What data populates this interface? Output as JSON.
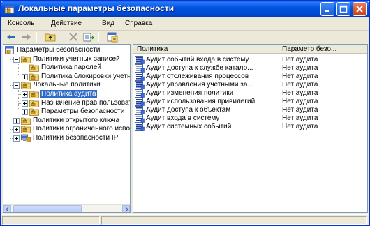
{
  "window": {
    "title": "Локальные параметры безопасности"
  },
  "menu": [
    "Консоль",
    "Действие",
    "Вид",
    "Справка"
  ],
  "toolbar": {
    "buttons": [
      "back-icon",
      "forward-icon",
      "up-folder-icon",
      "delete-icon",
      "export-list-icon",
      "properties-icon"
    ]
  },
  "tree": {
    "items": [
      {
        "label": "Параметры безопасности",
        "icon": "security-settings-icon",
        "level": 0,
        "expander": "minus"
      },
      {
        "label": "Политики учетных записей",
        "icon": "folder-icon",
        "level": 1,
        "expander": "minus"
      },
      {
        "label": "Политика паролей",
        "icon": "folder-icon",
        "level": 2,
        "expander": "none"
      },
      {
        "label": "Политика блокировки учетной записи",
        "icon": "folder-icon",
        "level": 2,
        "expander": "plus"
      },
      {
        "label": "Локальные политики",
        "icon": "folder-icon",
        "level": 1,
        "expander": "minus"
      },
      {
        "label": "Политика аудита",
        "icon": "folder-icon",
        "level": 2,
        "expander": "plus",
        "selected": true
      },
      {
        "label": "Назначение прав пользователя",
        "icon": "folder-icon",
        "level": 2,
        "expander": "plus"
      },
      {
        "label": "Параметры безопасности",
        "icon": "folder-icon",
        "level": 2,
        "expander": "plus"
      },
      {
        "label": "Политики открытого ключа",
        "icon": "folder-icon",
        "level": 1,
        "expander": "plus"
      },
      {
        "label": "Политики ограниченного использования программ",
        "icon": "folder-icon",
        "level": 1,
        "expander": "plus"
      },
      {
        "label": "Политики безопасности IP",
        "icon": "ip-security-icon",
        "level": 1,
        "expander": "plus"
      }
    ]
  },
  "list": {
    "columns": [
      "Политика",
      "Параметр безо..."
    ],
    "rows": [
      {
        "name": "Аудит событий входа в систему",
        "value": "Нет аудита"
      },
      {
        "name": "Аудит доступа к службе катало...",
        "value": "Нет аудита"
      },
      {
        "name": "Аудит отслеживания процессов",
        "value": "Нет аудита"
      },
      {
        "name": "Аудит управления учетными за...",
        "value": "Нет аудита"
      },
      {
        "name": "Аудит изменения политики",
        "value": "Нет аудита"
      },
      {
        "name": "Аудит использования привилегий",
        "value": "Нет аудита"
      },
      {
        "name": "Аудит доступа к объектам",
        "value": "Нет аудита"
      },
      {
        "name": "Аудит входа в систему",
        "value": "Нет аудита"
      },
      {
        "name": "Аудит системных событий",
        "value": "Нет аудита"
      }
    ],
    "row_icon": "audit-policy-icon"
  },
  "colors": {
    "titlebar": "#0054e3",
    "selection": "#316ac5",
    "face": "#ece9d8"
  }
}
